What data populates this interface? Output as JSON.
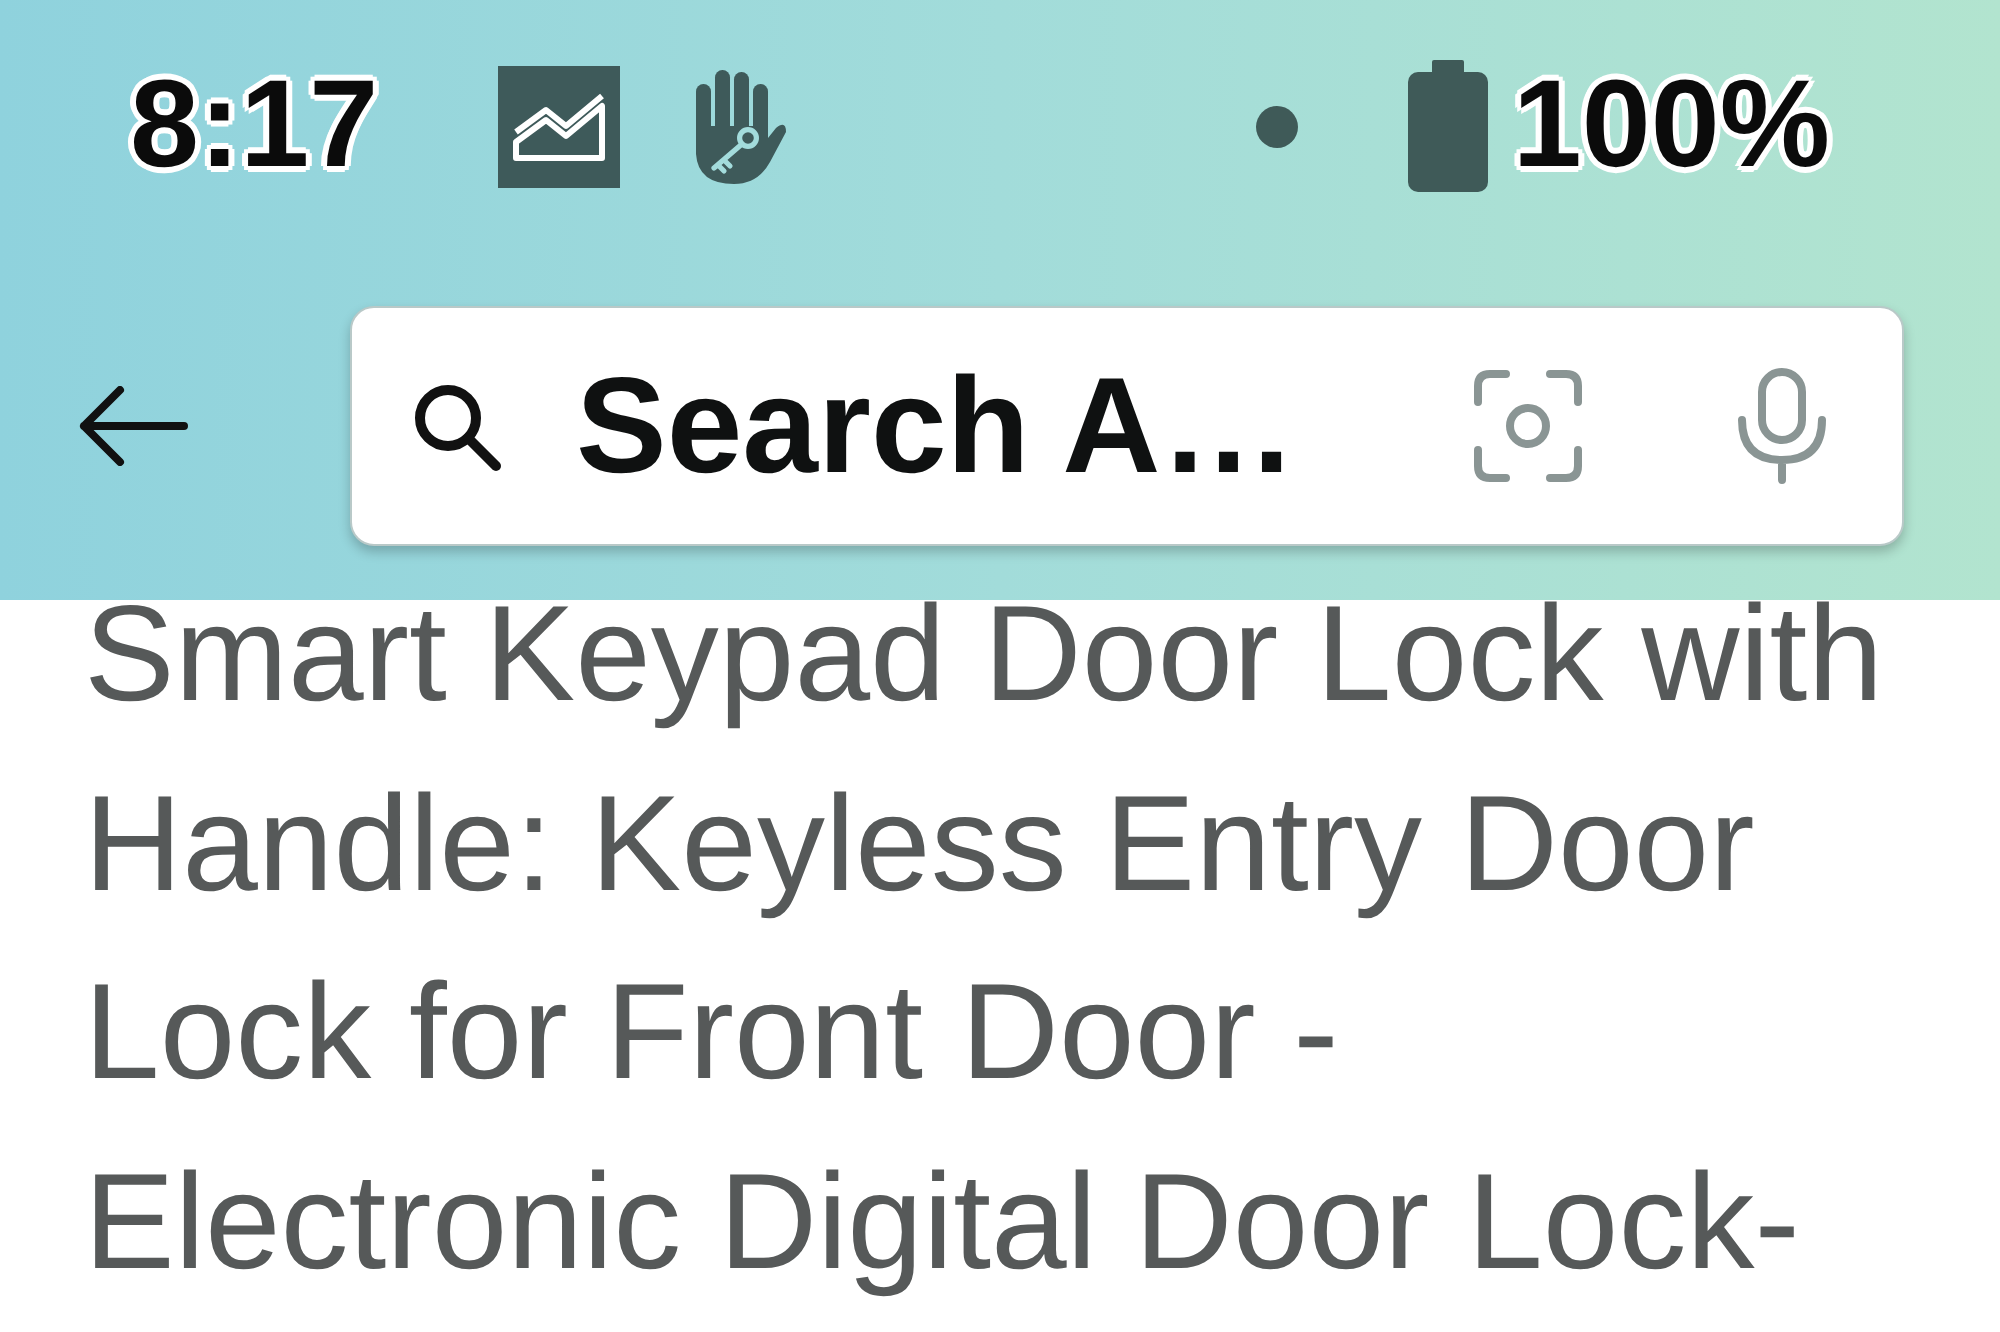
{
  "status_bar": {
    "time": "8:17",
    "battery": "100%"
  },
  "search_bar": {
    "query": "Search A…"
  },
  "product": {
    "title": "Smart Keypad Door Lock with Handle: Keyless Entry Door Lock for Front Door - Electronic Digital Door Lock-"
  }
}
